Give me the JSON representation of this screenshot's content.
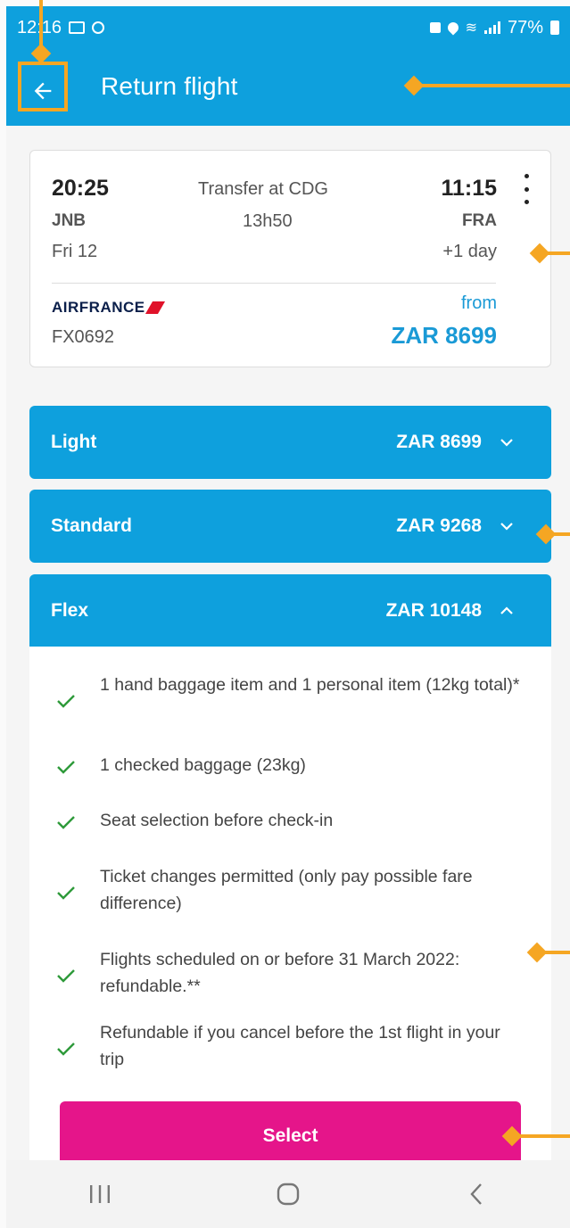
{
  "status_bar": {
    "time": "12:16",
    "battery": "77%"
  },
  "app_bar": {
    "title": "Return flight"
  },
  "flight": {
    "depart_time": "20:25",
    "transfer": "Transfer at CDG",
    "arrive_time": "11:15",
    "origin": "JNB",
    "duration": "13h50",
    "destination": "FRA",
    "date": "Fri 12",
    "day_offset": "+1 day",
    "airline": "AIRFRANCE",
    "flight_number": "FX0692",
    "from_label": "from",
    "price": "ZAR 8699"
  },
  "fares": [
    {
      "name": "Light",
      "price": "ZAR 8699",
      "expanded": false
    },
    {
      "name": "Standard",
      "price": "ZAR 9268",
      "expanded": false
    },
    {
      "name": "Flex",
      "price": "ZAR 10148",
      "expanded": true
    }
  ],
  "flex_benefits": [
    "1 hand baggage item and 1 personal item (12kg total)*",
    "1 checked baggage (23kg)",
    "Seat selection before check-in",
    "Ticket changes permitted (only pay possible fare difference)",
    "Flights scheduled on or before 31 March 2022: refundable.**",
    "Refundable if you cancel before the 1st flight in your trip"
  ],
  "select_label": "Select",
  "colors": {
    "brand_blue": "#0ea0dd",
    "price_blue": "#1a9ad6",
    "select_pink": "#e5158a",
    "check_green": "#2e9a3a",
    "annotation": "#f5a623"
  },
  "icons": {
    "back": "arrow-left-icon",
    "more": "more-vertical-icon",
    "expand": "chevron-down-icon",
    "collapse": "chevron-up-icon",
    "check": "check-icon",
    "nav_recents": "recents-icon",
    "nav_home": "home-icon",
    "nav_back": "nav-back-icon"
  }
}
